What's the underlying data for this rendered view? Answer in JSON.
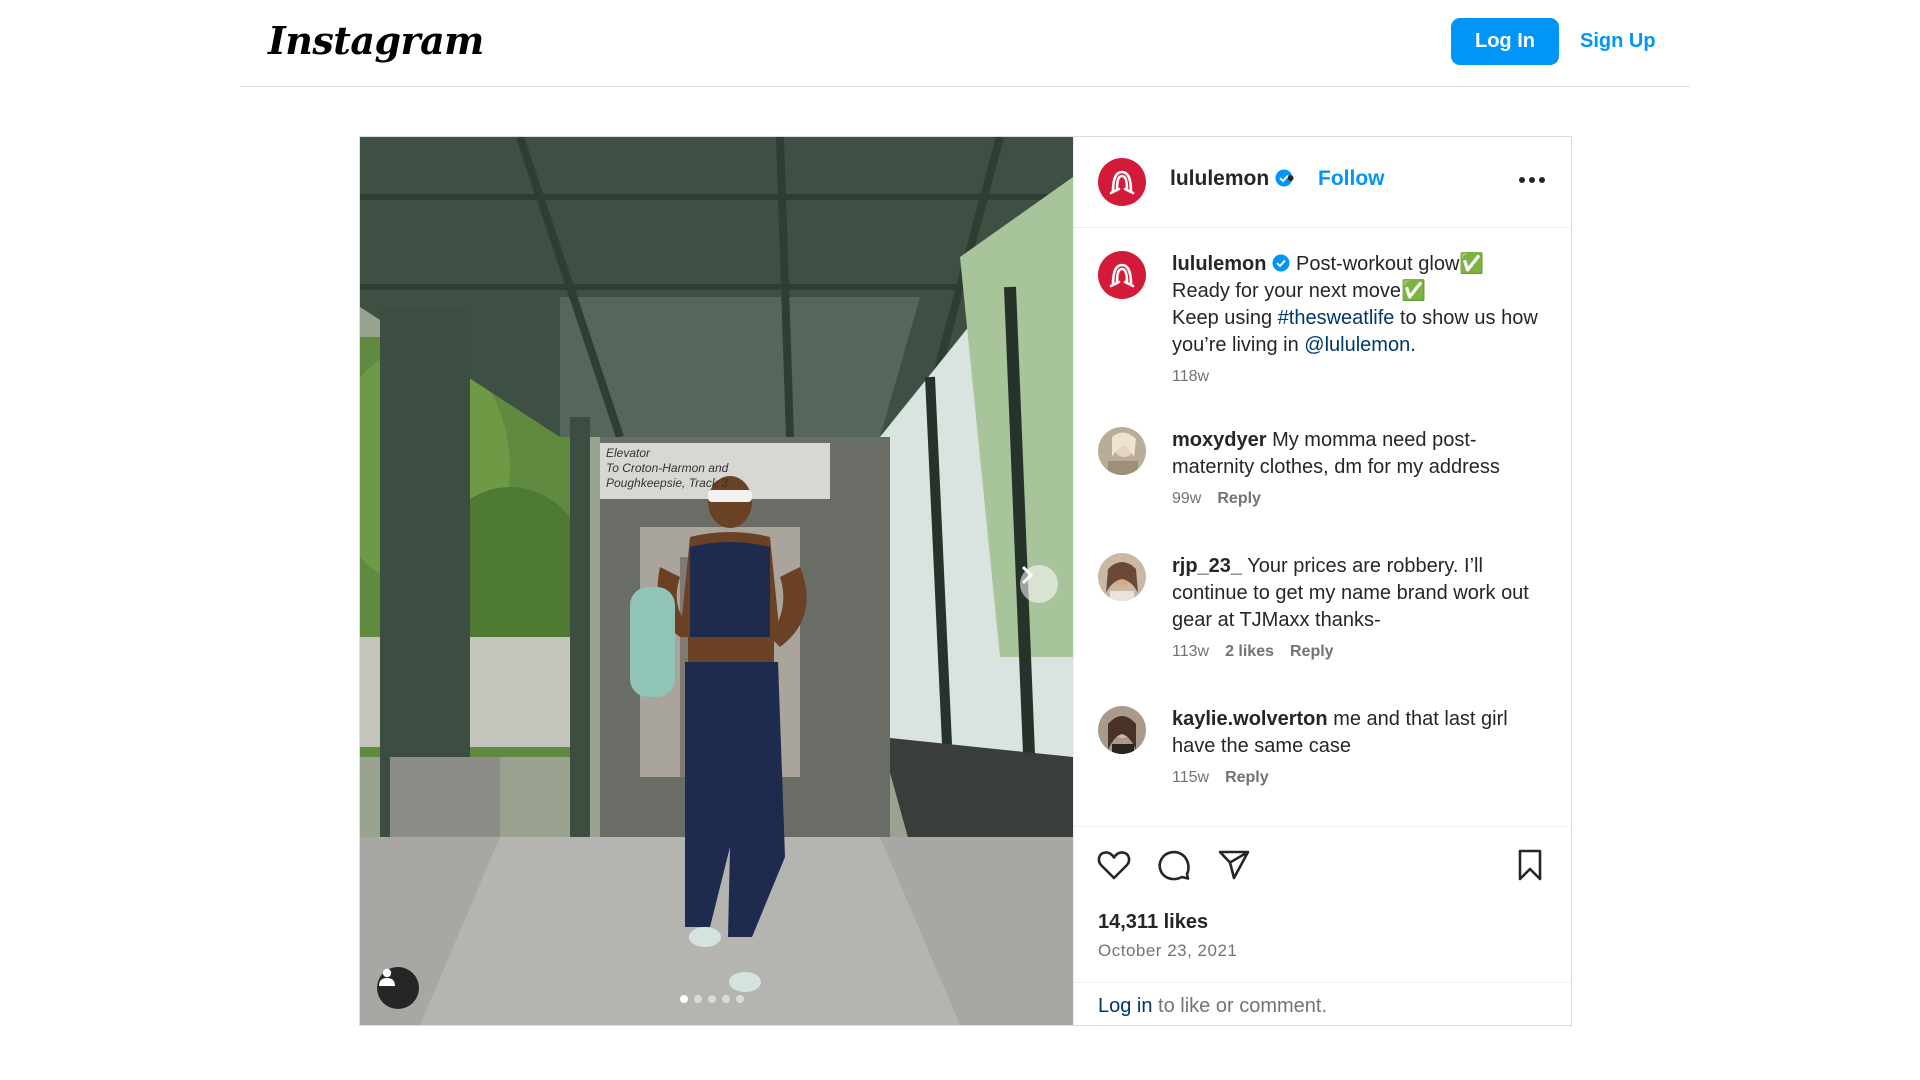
{
  "header": {
    "logo": "Instagram",
    "login_label": "Log In",
    "signup_label": "Sign Up"
  },
  "post": {
    "username": "lululemon",
    "separator": "•",
    "follow_label": "Follow",
    "caption": {
      "username": "lululemon",
      "line1": "Post-workout glow✅",
      "line2": "Ready for your next move✅",
      "line3_pre": "Keep using ",
      "hashtag": "#thesweatlife",
      "line3_post": " to show us how you’re living in ",
      "mention": "@lululemon",
      "end": ".",
      "time": "118w"
    },
    "comments": [
      {
        "username": "moxydyer",
        "text": "My momma need post-maternity clothes, dm for my address",
        "time": "99w",
        "likes": "",
        "reply_label": "Reply"
      },
      {
        "username": "rjp_23_",
        "text": "Your prices are robbery. I’ll continue to get my name brand work out gear at TJMaxx thanks-",
        "time": "113w",
        "likes": "2 likes",
        "reply_label": "Reply"
      },
      {
        "username": "kaylie.wolverton",
        "text": "me and that last girl have the same case",
        "time": "115w",
        "likes": "",
        "reply_label": "Reply"
      }
    ],
    "likes": "14,311 likes",
    "date": "October 23, 2021",
    "login_prompt": {
      "link": "Log in",
      "text": " to like or comment."
    },
    "photo": {
      "sign_line1": "Elevator",
      "sign_line2": "To Croton-Harmon and",
      "sign_line3": "Poughkeepsie, Track 3"
    },
    "carousel": {
      "count": 5,
      "active_index": 0
    }
  },
  "colors": {
    "accent": "#0095f6",
    "brand_red": "#d31a38",
    "link_dark": "#00376b",
    "muted": "#737373"
  }
}
